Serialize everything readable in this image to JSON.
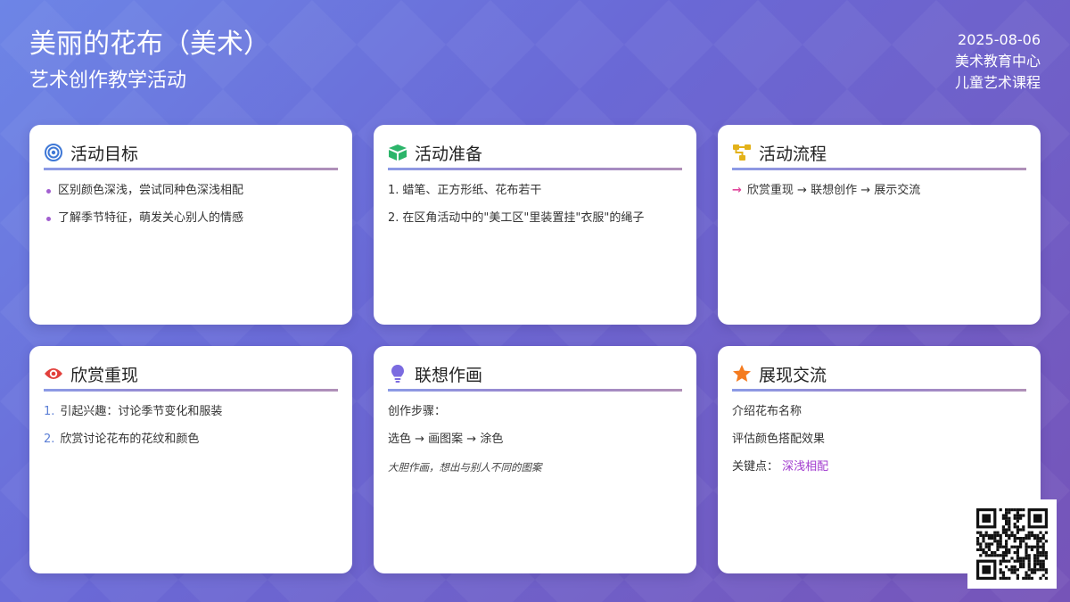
{
  "header": {
    "title": "美丽的花布（美术）",
    "subtitle": "艺术创作教学活动",
    "date": "2025-08-06",
    "org": "美术教育中心",
    "course": "儿童艺术课程"
  },
  "cards": {
    "goals": {
      "title": "活动目标",
      "icon": "bullseye-icon",
      "items": [
        "区别颜色深浅，尝试同种色深浅相配",
        "了解季节特征，萌发关心别人的情感"
      ]
    },
    "prep": {
      "title": "活动准备",
      "icon": "box-icon",
      "items": [
        {
          "num": "1.",
          "text": "蜡笔、正方形纸、花布若干"
        },
        {
          "num": "2.",
          "text": "在区角活动中的\"美工区\"里装置挂\"衣服\"的绳子"
        }
      ]
    },
    "flow": {
      "title": "活动流程",
      "icon": "flow-icon",
      "arrow": "→",
      "text": "欣赏重现 → 联想创作 → 展示交流"
    },
    "appreciate": {
      "title": "欣赏重现",
      "icon": "eye-icon",
      "items": [
        {
          "num": "1.",
          "text": "引起兴趣：讨论季节变化和服装"
        },
        {
          "num": "2.",
          "text": "欣赏讨论花布的花纹和颜色"
        }
      ]
    },
    "create": {
      "title": "联想作画",
      "icon": "lightbulb-icon",
      "steps_label": "创作步骤：",
      "steps": "选色 → 画图案 → 涂色",
      "note": "大胆作画，想出与别人不同的图案"
    },
    "show": {
      "title": "展现交流",
      "icon": "star-icon",
      "line1": "介绍花布名称",
      "line2": "评估颜色搭配效果",
      "key_label": "关键点：",
      "key_value": "深浅相配"
    }
  },
  "colors": {
    "accent_pink": "#e0479c",
    "accent_purple": "#a23ccf",
    "list_blue": "#5c7fd6",
    "icon_blue": "#3f78d6",
    "icon_green": "#2cb56a",
    "icon_yellow": "#e3b21a",
    "icon_red": "#e2403c",
    "icon_violet": "#7b6be0",
    "icon_orange": "#f47b1f"
  }
}
